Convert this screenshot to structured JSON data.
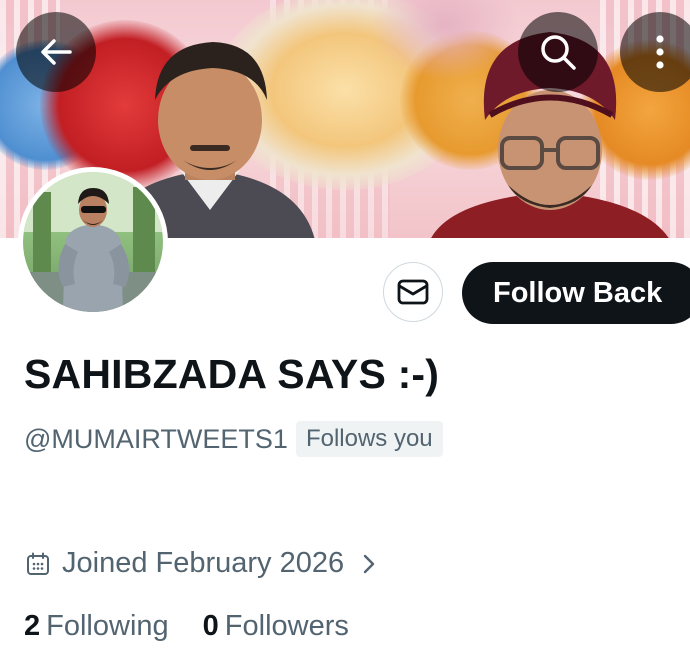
{
  "header": {
    "back_icon": "arrow-left-icon",
    "search_icon": "search-icon",
    "more_icon": "more-vertical-icon"
  },
  "profile": {
    "display_name": "SAHIBZADA SAYS :-)",
    "handle": "@MUMAIRTWEETS1",
    "follows_you_badge": "Follows you",
    "joined_text": "Joined February 2026",
    "following_count": "2",
    "following_label": "Following",
    "followers_count": "0",
    "followers_label": "Followers"
  },
  "actions": {
    "message_icon": "envelope-icon",
    "follow_back_label": "Follow Back"
  },
  "colors": {
    "text_primary": "#0f1419",
    "text_secondary": "#536471",
    "button_dark": "#0f1419",
    "badge_bg": "#eff3f4"
  }
}
